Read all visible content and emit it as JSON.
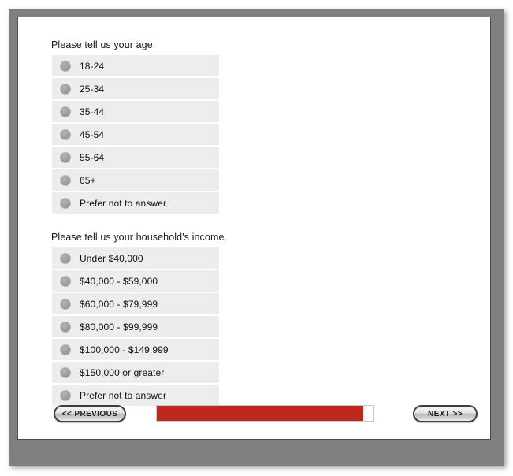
{
  "survey": {
    "questions": [
      {
        "id": "age",
        "title": "Please tell us your age.",
        "options": [
          {
            "label": "18-24"
          },
          {
            "label": "25-34"
          },
          {
            "label": "35-44"
          },
          {
            "label": "45-54"
          },
          {
            "label": "55-64"
          },
          {
            "label": "65+"
          },
          {
            "label": "Prefer not to answer"
          }
        ]
      },
      {
        "id": "income",
        "title": "Please tell us your household's income.",
        "options": [
          {
            "label": "Under $40,000"
          },
          {
            "label": "$40,000 - $59,000"
          },
          {
            "label": "$60,000 - $79,999"
          },
          {
            "label": "$80,000 - $99,999"
          },
          {
            "label": "$100,000 - $149,999"
          },
          {
            "label": "$150,000 or greater"
          },
          {
            "label": "Prefer not to answer"
          }
        ]
      }
    ]
  },
  "footer": {
    "previous_label": "<< PREVIOUS",
    "next_label": "NEXT >>",
    "progress": {
      "percent": 96,
      "fill_color": "#c0271f",
      "track_color": "#ffffff"
    }
  },
  "icons": {
    "radio": "radio-unselected-icon"
  },
  "colors": {
    "frame": "#808080",
    "panel": "#ffffff",
    "option_row": "#ededed",
    "radio": "#9d9d9d",
    "accent": "#c0271f"
  }
}
